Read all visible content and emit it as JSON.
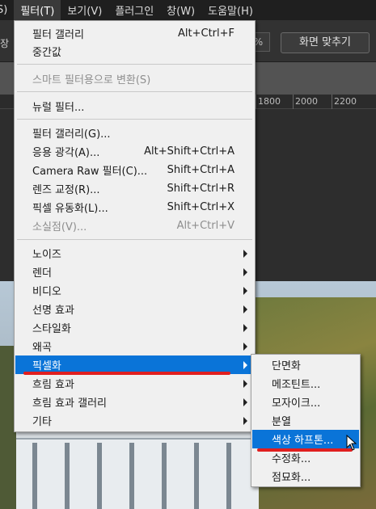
{
  "menubar": {
    "items": [
      "S)",
      "필터(T)",
      "보기(V)",
      "플러그인",
      "창(W)",
      "도움말(H)"
    ]
  },
  "options": {
    "left_text": "장",
    "percent": "%",
    "fit_button": "화면 맞추기"
  },
  "ruler": {
    "ticks": [
      "1800",
      "2000",
      "2200"
    ]
  },
  "filter_menu": {
    "items": [
      {
        "label": "필터 갤러리",
        "shortcut": "Alt+Ctrl+F"
      },
      {
        "label": "중간값",
        "shortcut": ""
      },
      {
        "label": "스마트 필터용으로 변환(S)",
        "shortcut": ""
      },
      {
        "label": "뉴럴 필터...",
        "shortcut": ""
      },
      {
        "label": "필터 갤러리(G)...",
        "shortcut": ""
      },
      {
        "label": "응용 광각(A)...",
        "shortcut": "Alt+Shift+Ctrl+A"
      },
      {
        "label": "Camera Raw 필터(C)...",
        "shortcut": "Shift+Ctrl+A"
      },
      {
        "label": "렌즈 교정(R)...",
        "shortcut": "Shift+Ctrl+R"
      },
      {
        "label": "픽셀 유동화(L)...",
        "shortcut": "Shift+Ctrl+X"
      },
      {
        "label": "소실점(V)...",
        "shortcut": "Alt+Ctrl+V"
      },
      {
        "label": "노이즈",
        "shortcut": ""
      },
      {
        "label": "렌더",
        "shortcut": ""
      },
      {
        "label": "비디오",
        "shortcut": ""
      },
      {
        "label": "선명 효과",
        "shortcut": ""
      },
      {
        "label": "스타일화",
        "shortcut": ""
      },
      {
        "label": "왜곡",
        "shortcut": ""
      },
      {
        "label": "픽셀화",
        "shortcut": ""
      },
      {
        "label": "흐림 효과",
        "shortcut": ""
      },
      {
        "label": "흐림 효과 갤러리",
        "shortcut": ""
      },
      {
        "label": "기타",
        "shortcut": ""
      }
    ]
  },
  "pixelate_submenu": {
    "items": [
      "단면화",
      "메조틴트...",
      "모자이크...",
      "분열",
      "색상 하프톤...",
      "수정화...",
      "점묘화..."
    ]
  },
  "colors": {
    "highlight": "#0a74d8",
    "annotation": "#e01f1f"
  }
}
